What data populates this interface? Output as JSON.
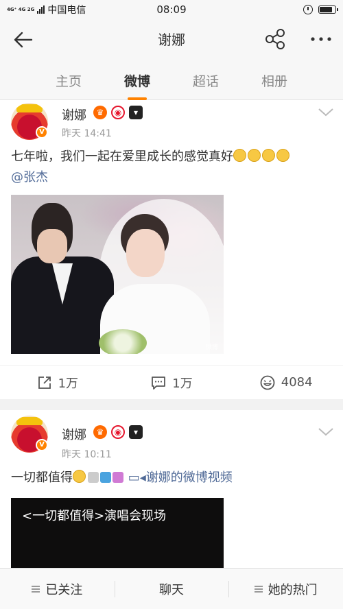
{
  "status_bar": {
    "network": "4G⁺ 4G 2G",
    "carrier": "中国电信",
    "time": "08:09"
  },
  "nav": {
    "title": "谢娜"
  },
  "tabs": [
    {
      "label": "主页"
    },
    {
      "label": "微博"
    },
    {
      "label": "超话"
    },
    {
      "label": "相册"
    }
  ],
  "posts": [
    {
      "user": "谢娜",
      "time": "昨天 14:41",
      "text": "七年啦，我们一起在爱里成长的感觉真好",
      "mention": "@张杰",
      "image_watermark": "微博",
      "actions": {
        "repost": "1万",
        "comment": "1万",
        "like": "4084"
      }
    },
    {
      "user": "谢娜",
      "time": "昨天 10:11",
      "text": "一切都值得",
      "video_link": "谢娜的微博视频",
      "video_title": "<一切都值得>演唱会现场"
    }
  ],
  "bottom_bar": {
    "followed": "已关注",
    "chat": "聊天",
    "hot": "她的热门"
  },
  "colors": {
    "accent": "#ff8200",
    "link": "#506a97"
  }
}
